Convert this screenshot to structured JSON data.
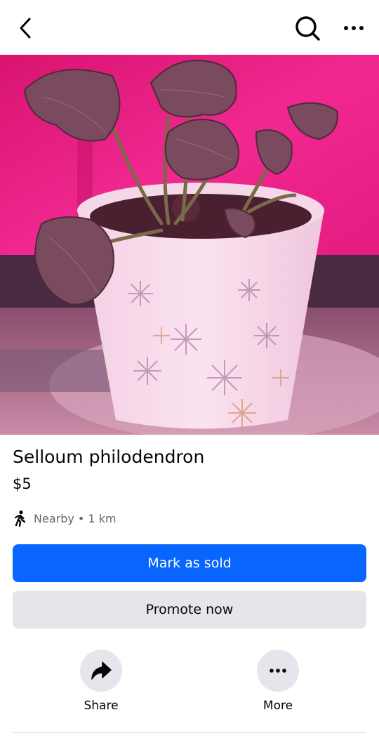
{
  "header": {
    "back_icon": "chevron-left-icon",
    "search_icon": "search-icon",
    "more_icon": "more-horizontal-icon"
  },
  "listing": {
    "photo_description": "potted plant",
    "title": "Selloum philodendron",
    "price": "$5",
    "location": "Nearby • 1 km",
    "location_icon": "walking-person-icon"
  },
  "buttons": {
    "primary": "Mark as sold",
    "secondary": "Promote now"
  },
  "actions": [
    {
      "label": "Share",
      "icon": "share-arrow-icon"
    },
    {
      "label": "More",
      "icon": "more-horizontal-icon"
    }
  ],
  "colors": {
    "primary_button": "#0866ff",
    "secondary_button": "#e4e6eb",
    "muted_text": "#65676b"
  }
}
